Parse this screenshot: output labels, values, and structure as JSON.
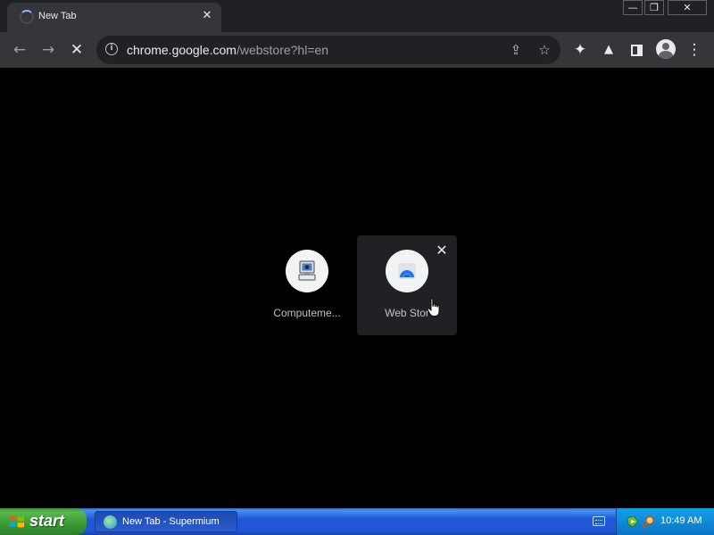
{
  "browser": {
    "tab": {
      "title": "New Tab",
      "close": "✕"
    },
    "window_controls": {
      "minimize": "—",
      "restore": "❐",
      "close": "✕"
    },
    "toolbar": {
      "back": "←",
      "forward": "→",
      "stop": "✕",
      "url_host": "chrome.google.com",
      "url_path": "/webstore?hl=en",
      "share": "⇪",
      "bookmark": "☆",
      "extensions": "✦",
      "labs": "▲",
      "menu": "⋮"
    }
  },
  "ntp": {
    "shortcuts": [
      {
        "label": "Computeme...",
        "icon": "computer-icon"
      },
      {
        "label": "Web Stor",
        "icon": "web-store-icon",
        "remove": "✕"
      }
    ]
  },
  "taskbar": {
    "start_label": "start",
    "task": {
      "label": "New Tab - Supermium"
    },
    "clock": "10:49 AM"
  }
}
